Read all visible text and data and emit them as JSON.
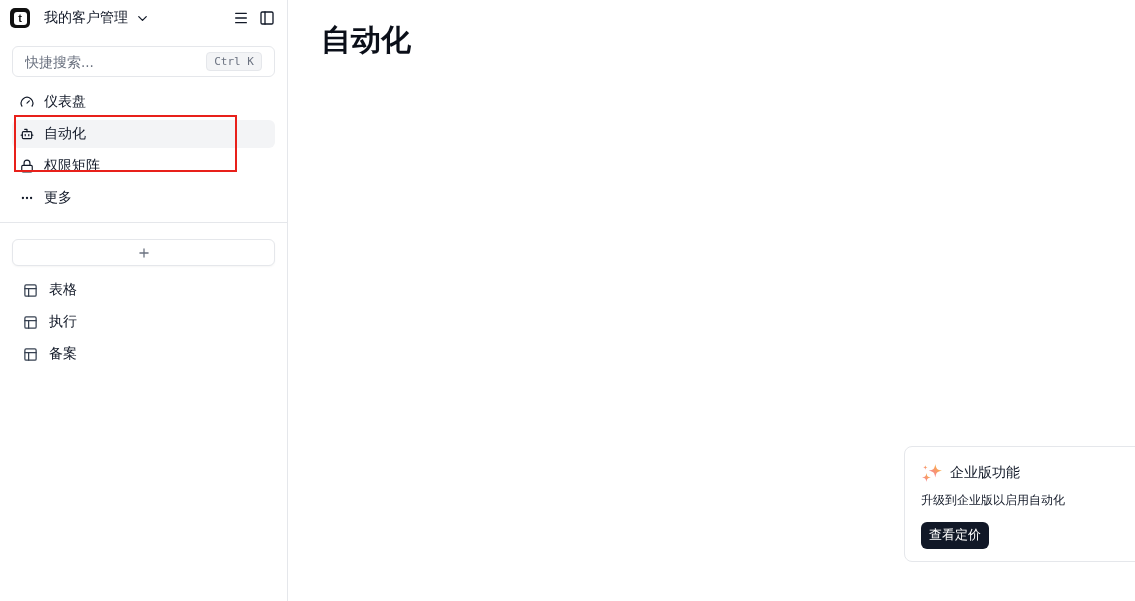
{
  "sidebar": {
    "workspace": {
      "logo_text": "t",
      "name": "我的客户管理"
    },
    "search": {
      "placeholder": "快捷搜索...",
      "shortcut": "Ctrl K"
    },
    "nav_items": [
      {
        "kind": "gauge",
        "label": "仪表盘",
        "selected": false
      },
      {
        "kind": "bot",
        "label": "自动化",
        "selected": true
      },
      {
        "kind": "lock",
        "label": "权限矩阵",
        "selected": false
      },
      {
        "kind": "more",
        "label": "更多",
        "selected": false
      }
    ],
    "tables": [
      {
        "label": "表格"
      },
      {
        "label": "执行"
      },
      {
        "label": "备案"
      }
    ]
  },
  "main": {
    "title": "自动化"
  },
  "upgrade_card": {
    "title": "企业版功能",
    "description": "升级到企业版以启用自动化",
    "button": "查看定价"
  },
  "annotation": {
    "highlight_frame": true
  }
}
